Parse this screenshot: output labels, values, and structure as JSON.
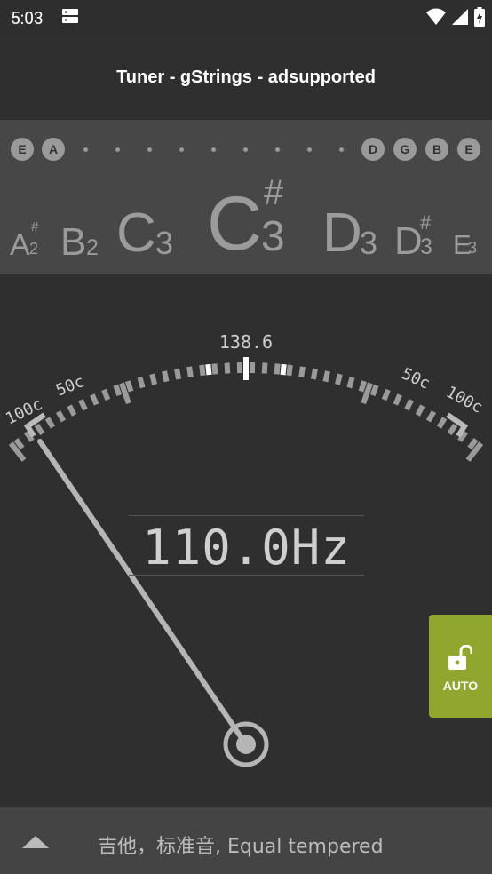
{
  "status": {
    "time": "5:03"
  },
  "app": {
    "title": "Tuner - gStrings - adsupported"
  },
  "strings": {
    "left": [
      "E",
      "A"
    ],
    "right": [
      "D",
      "G",
      "B",
      "E"
    ]
  },
  "notes": [
    {
      "letter": "A",
      "octave": "2",
      "accidental": "#"
    },
    {
      "letter": "B",
      "octave": "2",
      "accidental": ""
    },
    {
      "letter": "C",
      "octave": "3",
      "accidental": ""
    },
    {
      "letter": "C",
      "octave": "3",
      "accidental": "#"
    },
    {
      "letter": "D",
      "octave": "3",
      "accidental": ""
    },
    {
      "letter": "D",
      "octave": "3",
      "accidental": "#"
    },
    {
      "letter": "E",
      "octave": "3",
      "accidental": ""
    }
  ],
  "meter": {
    "target_frequency": "138.6",
    "left_labels": [
      "100c",
      "50c"
    ],
    "right_labels": [
      "50c",
      "100c"
    ],
    "frequency": "110.0Hz"
  },
  "auto": {
    "label": "AUTO"
  },
  "bottom": {
    "instrument": "吉他，标准音, Equal tempered"
  },
  "colors": {
    "accent": "#8fa72e",
    "background": "#2f2f2f",
    "strip": "#474747"
  }
}
